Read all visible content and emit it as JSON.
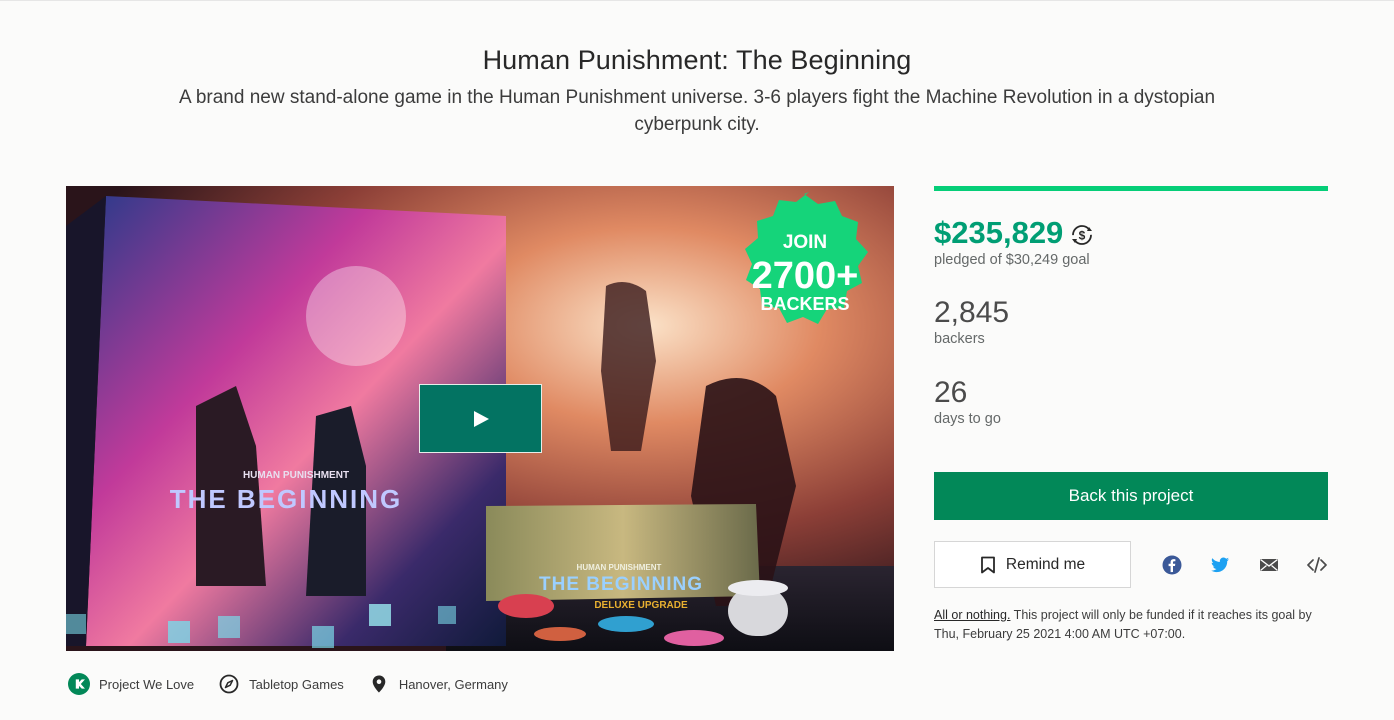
{
  "project": {
    "title": "Human Punishment: The Beginning",
    "blurb": "A brand new stand-alone game in the Human Punishment universe. 3-6 players fight the Machine Revolution in a dystopian cyberpunk city."
  },
  "media": {
    "badge_join": "JOIN",
    "badge_count": "2700+",
    "badge_backers": "BACKERS",
    "box_logo": "HUMAN PUNISHMENT",
    "box_title": "THE BEGINNING",
    "small_box_logo": "HUMAN PUNISHMENT",
    "small_box_title": "THE BEGINNING",
    "small_box_sub": "DELUXE UPGRADE",
    "play_icon": "play-icon"
  },
  "funding": {
    "pledged": "$235,829",
    "pledged_label": "pledged of $30,249 goal",
    "progress_fraction": 1.0,
    "backers": "2,845",
    "backers_label": "backers",
    "days": "26",
    "days_label": "days to go"
  },
  "actions": {
    "back_label": "Back this project",
    "remind_label": "Remind me",
    "share_icons": [
      "facebook-icon",
      "twitter-icon",
      "email-icon",
      "embed-icon"
    ]
  },
  "note": {
    "link": "All or nothing.",
    "text": " This project will only be funded if it reaches its goal by Thu, February 25 2021 4:00 AM UTC +07:00."
  },
  "tags": {
    "pwl": "Project We Love",
    "category": "Tabletop Games",
    "location": "Hanover, Germany"
  },
  "colors": {
    "accent": "#009e74",
    "progress": "#05ce78",
    "button": "#028858",
    "badge": "#15d47a"
  }
}
